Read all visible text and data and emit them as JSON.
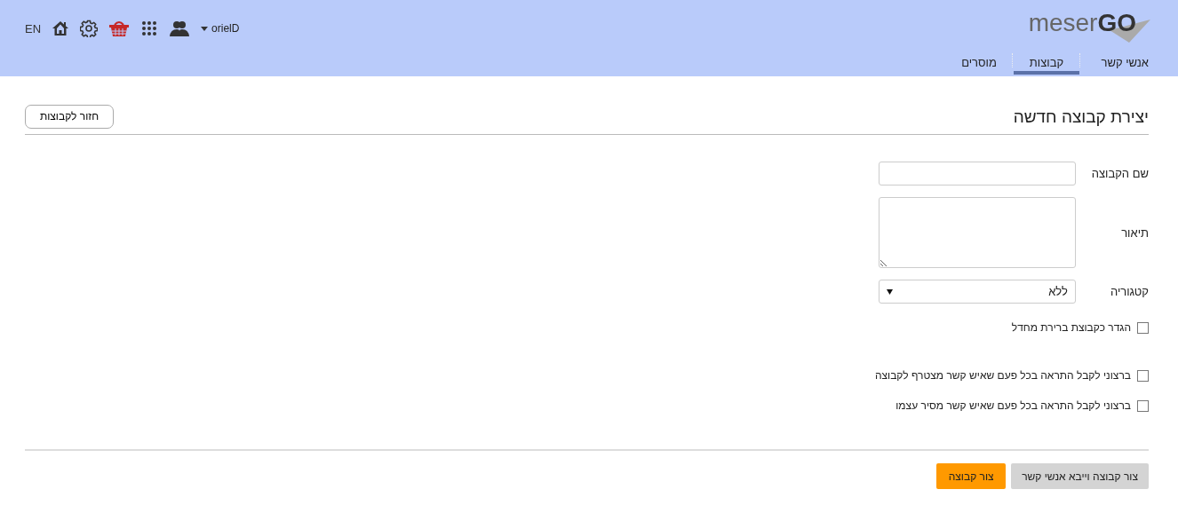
{
  "header": {
    "language": "EN",
    "user": "orielD",
    "logo": "meser**GO**",
    "tabs": [
      {
        "label": "אנשי קשר",
        "selected": false
      },
      {
        "label": "קבוצות",
        "selected": true
      },
      {
        "label": "מוסרים",
        "selected": false
      }
    ]
  },
  "page": {
    "title": "יצירת קבוצה חדשה",
    "back_button": "חזור לקבוצות"
  },
  "form": {
    "fields": [
      {
        "kind": "text",
        "label": "שם הקבוצה"
      },
      {
        "kind": "textarea",
        "label": "תיאור"
      },
      {
        "kind": "select",
        "label": "קטגוריה",
        "value": "ללא"
      }
    ],
    "checkboxes": [
      {
        "label": "הגדר כקבוצת ברירת מחדל",
        "checked": false
      },
      {
        "label": "ברצוני לקבל התראה בכל פעם שאיש קשר מצטרף לקבוצה",
        "checked": false
      },
      {
        "label": "ברצוני לקבל התראה בכל פעם שאיש קשר מסיר עצמו",
        "checked": false
      }
    ]
  },
  "footer": {
    "buttons": [
      {
        "label": "צור קבוצה וייבא אנשי קשר",
        "kind": "secondary"
      },
      {
        "label": "צור קבוצה",
        "kind": "primary"
      }
    ]
  }
}
